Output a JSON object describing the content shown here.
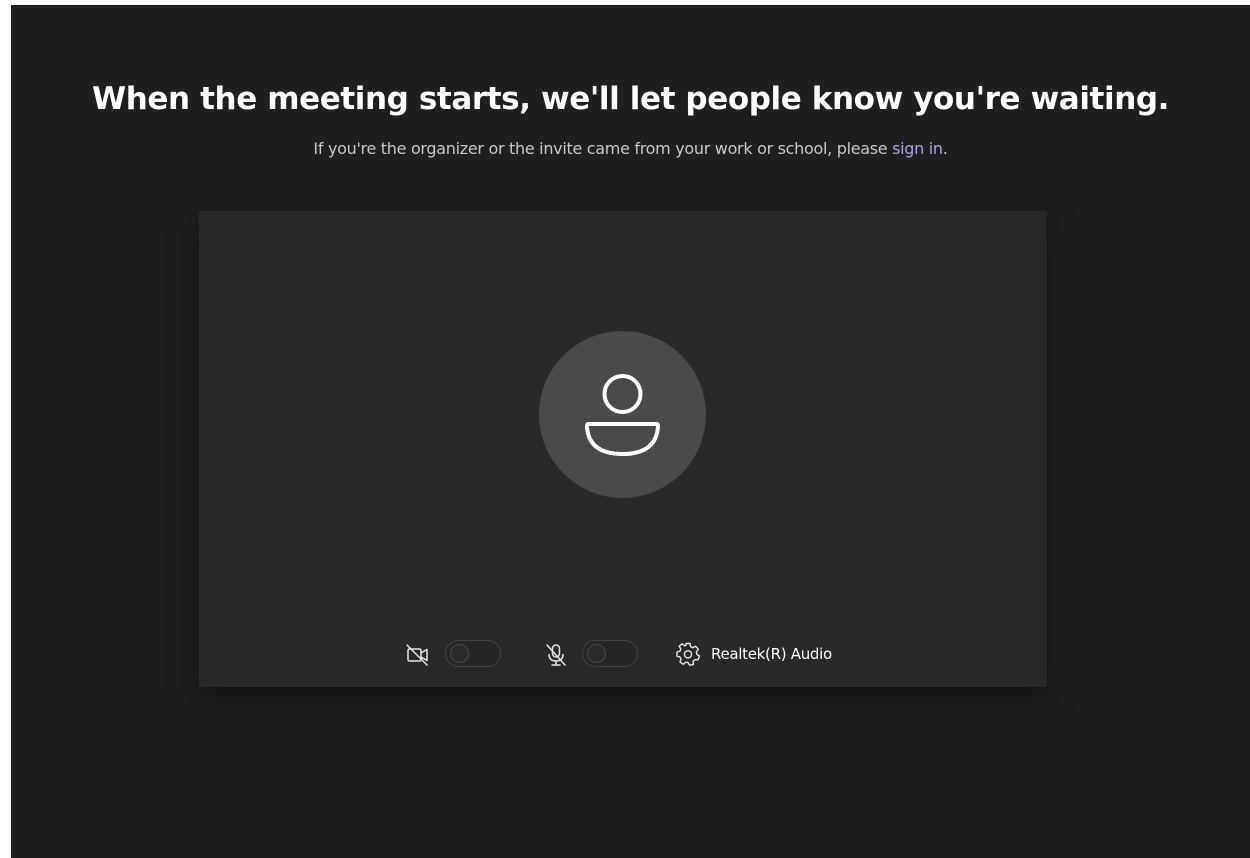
{
  "page": {
    "headline": "When the meeting starts, we'll let people know you're waiting.",
    "subtext_before": "If you're the organizer or the invite came from your work or school, please ",
    "sign_in_link": "sign in",
    "subtext_after": "."
  },
  "preview": {
    "avatar_icon": "person-icon",
    "camera": {
      "icon": "video-off-icon",
      "enabled": false
    },
    "microphone": {
      "icon": "mic-off-icon",
      "enabled": false
    },
    "device_settings": {
      "icon": "gear-icon",
      "label": "Realtek(R) Audio"
    }
  },
  "colors": {
    "background": "#1f1f1f",
    "panel": "#292929",
    "avatar": "#4a4a4a",
    "link": "#a9a2e6",
    "text": "#ffffff"
  }
}
